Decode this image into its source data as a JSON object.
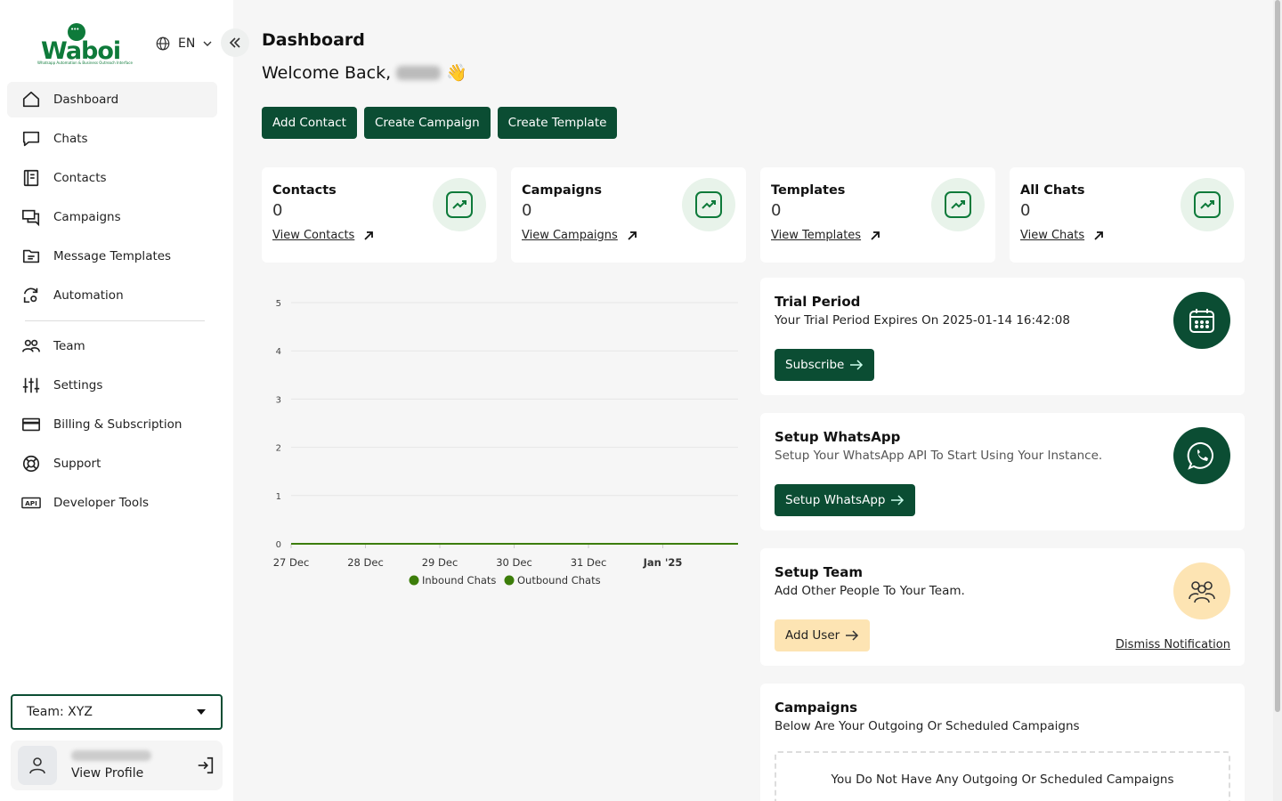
{
  "brand": {
    "logo_text": "Waboi",
    "tagline": "Whatsapp Automation & Business Outreach Interface"
  },
  "language": {
    "code": "EN"
  },
  "sidebar": {
    "items": [
      {
        "label": "Dashboard",
        "icon": "home-icon",
        "active": true
      },
      {
        "label": "Chats",
        "icon": "chat-icon"
      },
      {
        "label": "Contacts",
        "icon": "contacts-book-icon"
      },
      {
        "label": "Campaigns",
        "icon": "campaigns-icon"
      },
      {
        "label": "Message Templates",
        "icon": "folder-template-icon"
      },
      {
        "label": "Automation",
        "icon": "automation-icon"
      },
      {
        "label": "Team",
        "icon": "team-icon"
      },
      {
        "label": "Settings",
        "icon": "sliders-icon"
      },
      {
        "label": "Billing & Subscription",
        "icon": "credit-card-icon"
      },
      {
        "label": "Support",
        "icon": "lifebuoy-icon"
      },
      {
        "label": "Developer Tools",
        "icon": "api-icon"
      }
    ],
    "team_select": "Team: XYZ",
    "profile": {
      "view_label": "View Profile"
    }
  },
  "header": {
    "title": "Dashboard",
    "welcome": "Welcome Back,",
    "emoji": "👋"
  },
  "actions": [
    "Add Contact",
    "Create Campaign",
    "Create Template"
  ],
  "stats": [
    {
      "title": "Contacts",
      "value": "0",
      "link": "View Contacts"
    },
    {
      "title": "Campaigns",
      "value": "0",
      "link": "View Campaigns"
    },
    {
      "title": "Templates",
      "value": "0",
      "link": "View Templates"
    },
    {
      "title": "All Chats",
      "value": "0",
      "link": "View Chats"
    }
  ],
  "chart_data": {
    "type": "line",
    "title": "",
    "xlabel": "",
    "ylabel": "",
    "categories": [
      "27 Dec",
      "28 Dec",
      "29 Dec",
      "30 Dec",
      "31 Dec",
      "Jan '25"
    ],
    "ylim": [
      0,
      5
    ],
    "yticks": [
      0,
      1,
      2,
      3,
      4,
      5
    ],
    "grid": true,
    "legend_position": "bottom",
    "series": [
      {
        "name": "Inbound Chats",
        "color": "#3c7d0a",
        "values": [
          0,
          0,
          0,
          0,
          0,
          0
        ]
      },
      {
        "name": "Outbound Chats",
        "color": "#3c7d0a",
        "values": [
          0,
          0,
          0,
          0,
          0,
          0
        ]
      }
    ]
  },
  "cards": {
    "trial": {
      "title": "Trial Period",
      "desc": "Your Trial Period Expires On 2025-01-14 16:42:08",
      "button": "Subscribe"
    },
    "whatsapp": {
      "title": "Setup WhatsApp",
      "desc": "Setup Your WhatsApp API To Start Using Your Instance.",
      "button": "Setup WhatsApp"
    },
    "team": {
      "title": "Setup Team",
      "desc": "Add Other People To Your Team.",
      "button": "Add User",
      "dismiss": "Dismiss Notification"
    },
    "campaigns": {
      "title": "Campaigns",
      "desc": "Below Are Your Outgoing Or Scheduled Campaigns",
      "empty": "You Do Not Have Any Outgoing Or Scheduled Campaigns"
    }
  },
  "colors": {
    "primary": "#0b4d33",
    "accent_light": "#fde4b3",
    "chart_line": "#3c7d0a"
  }
}
